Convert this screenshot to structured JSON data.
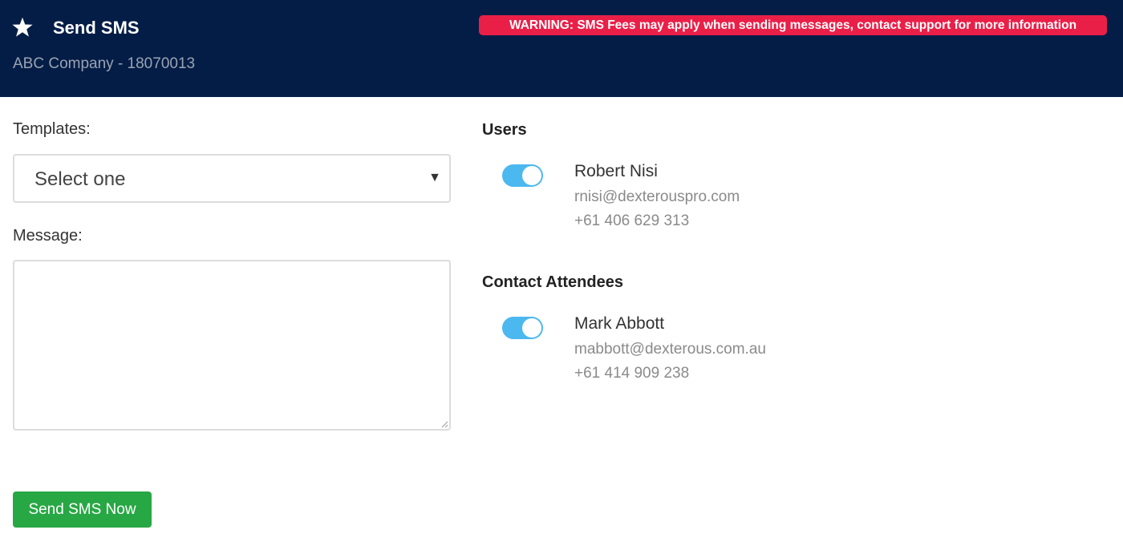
{
  "header": {
    "icon": "star-icon",
    "title": "Send SMS",
    "subtitle": "ABC Company - 18070013",
    "warning": "WARNING: SMS Fees may apply when sending messages, contact support for more information",
    "colors": {
      "background": "#041d46",
      "warning": "#ea1f48"
    }
  },
  "form": {
    "templates_label": "Templates:",
    "templates_selected": "Select one",
    "message_label": "Message:",
    "message_value": ""
  },
  "users": {
    "title": "Users",
    "items": [
      {
        "name": "Robert Nisi",
        "email": "rnisi@dexterouspro.com",
        "phone": "+61 406 629 313",
        "selected": true
      }
    ]
  },
  "attendees": {
    "title": "Contact Attendees",
    "items": [
      {
        "name": "Mark Abbott",
        "email": "mabbott@dexterous.com.au",
        "phone": "+61 414 909 238",
        "selected": true
      }
    ]
  },
  "actions": {
    "send_label": "Send SMS Now",
    "send_color": "#28a745"
  },
  "toggle_color": "#4cb8f0"
}
